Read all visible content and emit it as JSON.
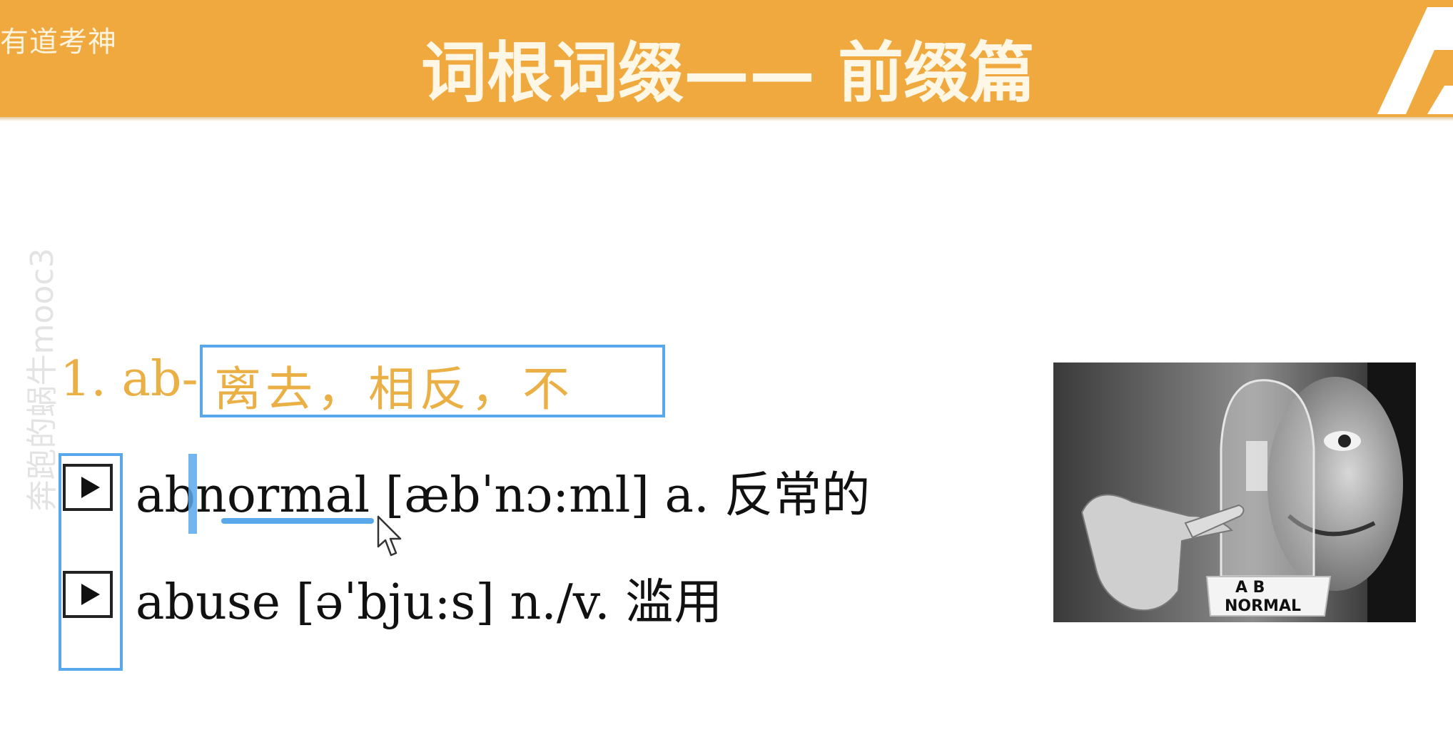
{
  "header": {
    "brand": "有道考神",
    "title": "词根词缀—— 前缀篇"
  },
  "watermark": "奔跑的蜗牛mooc3",
  "prefix": {
    "label": "1. ab-",
    "meaning": "离去，相反，不"
  },
  "words": [
    {
      "text": "abnormal [æbˈnɔ:ml] a. 反常的"
    },
    {
      "text": "abuse [əˈbju:s] n./v. 滥用"
    }
  ],
  "image": {
    "sign_text": "AB NORMAL"
  },
  "colors": {
    "banner": "#efa93e",
    "accent": "#eab046",
    "highlight": "#5aa8ec"
  }
}
